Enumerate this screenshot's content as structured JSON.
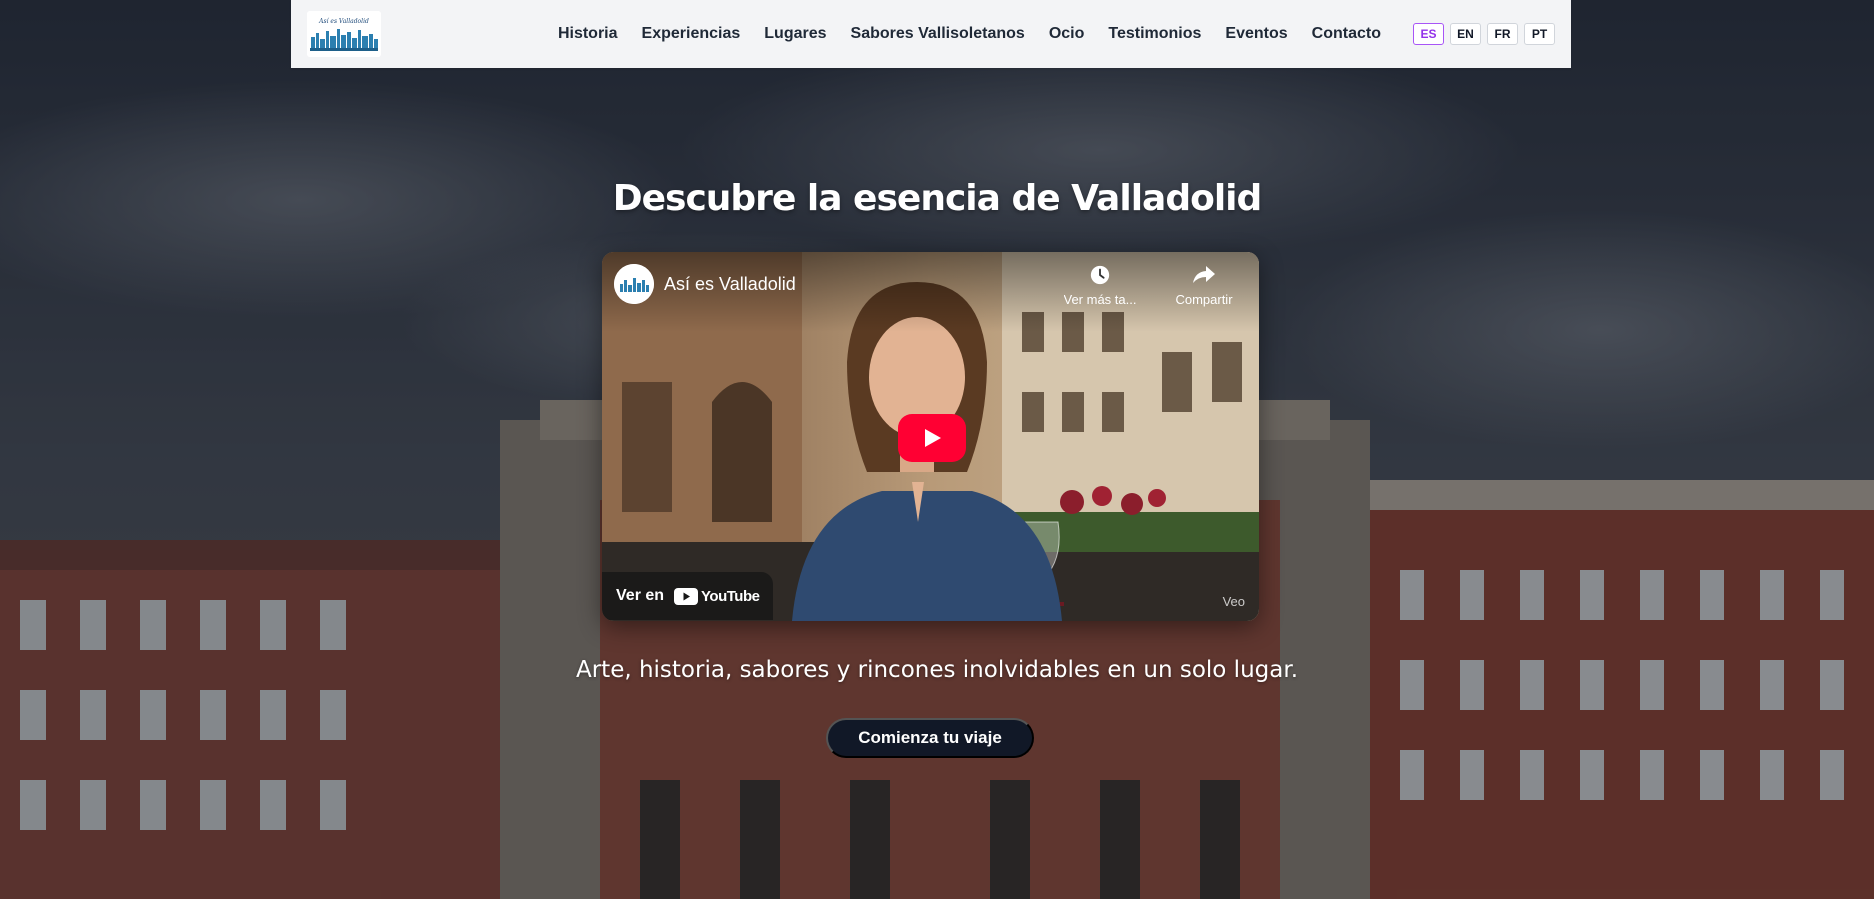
{
  "header": {
    "logo_text": "Así es Valladolid",
    "nav": [
      "Historia",
      "Experiencias",
      "Lugares",
      "Sabores Vallisoletanos",
      "Ocio",
      "Testimonios",
      "Eventos",
      "Contacto"
    ],
    "languages": [
      {
        "code": "ES",
        "active": true
      },
      {
        "code": "EN",
        "active": false
      },
      {
        "code": "FR",
        "active": false
      },
      {
        "code": "PT",
        "active": false
      }
    ]
  },
  "hero": {
    "title": "Descubre la esencia de Valladolid",
    "subtitle": "Arte, historia, sabores y rincones inolvidables en un solo lugar.",
    "cta_label": "Comienza tu viaje",
    "background_icon": "plaza-mayor-background"
  },
  "video": {
    "channel_name": "Así es Valladolid",
    "watch_later_label": "Ver más ta...",
    "share_label": "Compartir",
    "watch_on_label": "Ver en",
    "youtube_label": "YouTube",
    "watermark": "Veo",
    "play_icon": "play-icon"
  },
  "colors": {
    "header_bg": "#f3f4f6",
    "active_lang": "#9333ea",
    "cta_bg": "#111827",
    "youtube_red": "#ff0033"
  }
}
